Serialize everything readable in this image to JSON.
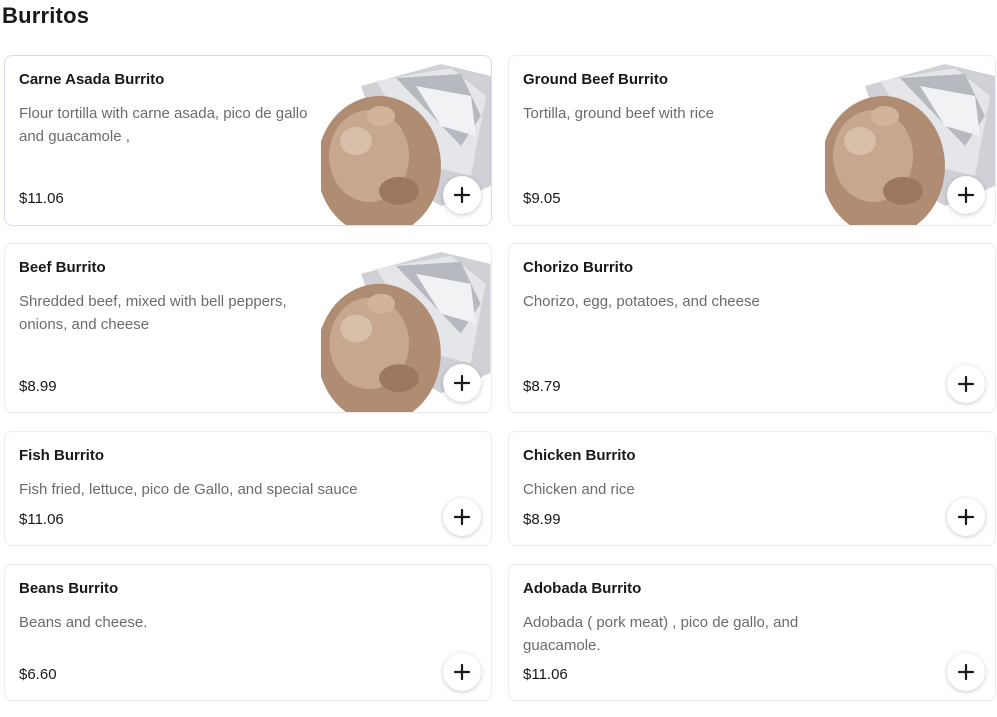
{
  "section": {
    "title": "Burritos"
  },
  "items": [
    {
      "name": "Carne Asada Burrito",
      "description": "Flour tortilla with carne asada, pico de gallo and guacamole ,",
      "price": "$11.06",
      "has_image": true,
      "add_icon": "plus-icon"
    },
    {
      "name": "Ground Beef Burrito",
      "description": "Tortilla, ground beef with rice",
      "price": "$9.05",
      "has_image": true,
      "add_icon": "plus-icon"
    },
    {
      "name": "Beef Burrito",
      "description": "Shredded beef, mixed with bell peppers, onions, and cheese",
      "price": "$8.99",
      "has_image": true,
      "add_icon": "plus-icon"
    },
    {
      "name": "Chorizo Burrito",
      "description": "Chorizo, egg, potatoes, and cheese",
      "price": "$8.79",
      "has_image": false,
      "add_icon": "plus-icon"
    },
    {
      "name": "Fish Burrito",
      "description": "Fish fried, lettuce, pico de Gallo, and special sauce",
      "price": "$11.06",
      "has_image": false,
      "add_icon": "plus-icon"
    },
    {
      "name": "Chicken Burrito",
      "description": "Chicken and rice",
      "price": "$8.99",
      "has_image": false,
      "add_icon": "plus-icon"
    },
    {
      "name": "Beans Burrito",
      "description": "Beans and cheese.",
      "price": "$6.60",
      "has_image": false,
      "add_icon": "plus-icon"
    },
    {
      "name": "Adobada Burrito",
      "description": "Adobada ( pork meat) , pico de gallo, and guacamole.",
      "price": "$11.06",
      "has_image": false,
      "add_icon": "plus-icon"
    }
  ],
  "colors": {
    "text": "#191919",
    "muted": "#6b6b6b",
    "border": "#ececec"
  }
}
